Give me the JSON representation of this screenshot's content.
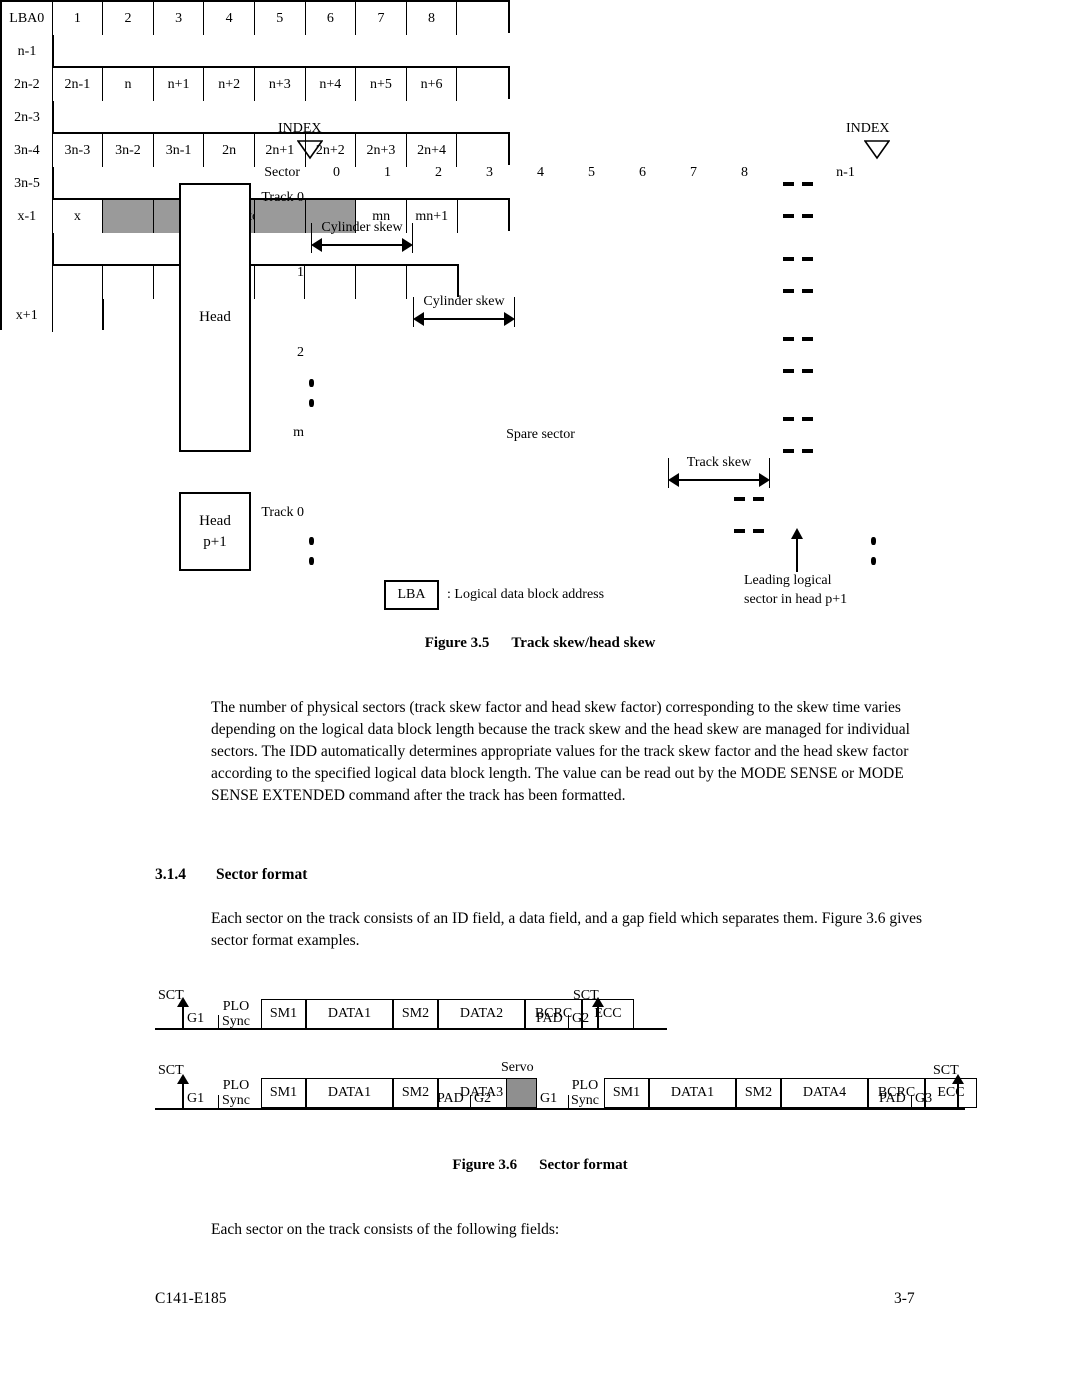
{
  "figure35": {
    "index_left_label": "INDEX",
    "index_right_label": "INDEX",
    "sector_label": "Sector",
    "head_label": "Head",
    "head2_label_line1": "Head",
    "head2_label_line2": "p+1",
    "sector_numbers": [
      "0",
      "1",
      "2",
      "3",
      "4",
      "5",
      "6",
      "7",
      "8"
    ],
    "sector_number_last": "n-1",
    "rows": [
      {
        "label": "Track 0",
        "cells": [
          "LBA0",
          "1",
          "2",
          "3",
          "4",
          "5",
          "6",
          "7",
          "8",
          ""
        ],
        "tail": [
          "n-1"
        ]
      },
      {
        "label": "1",
        "cells": [
          "2n-2",
          "2n-1",
          "n",
          "n+1",
          "n+2",
          "n+3",
          "n+4",
          "n+5",
          "n+6",
          ""
        ],
        "tail": [
          "2n-3"
        ]
      },
      {
        "label": "2",
        "cells": [
          "3n-4",
          "3n-3",
          "3n-2",
          "3n-1",
          "2n",
          "2n+1",
          "2n+2",
          "2n+3",
          "2n+4",
          ""
        ],
        "tail": [
          "3n-5"
        ]
      },
      {
        "label": "m",
        "cells": [
          "x-1",
          "x",
          "",
          "",
          "Spare sector",
          "",
          "",
          "mn",
          "mn+1",
          ""
        ],
        "tail": [
          ""
        ]
      }
    ],
    "last_row": {
      "label": "Track 0",
      "cells": [
        "",
        "",
        "",
        "",
        "",
        "",
        "",
        "",
        ""
      ],
      "tail": [
        "x+1",
        ""
      ]
    },
    "spare_sector_text": "Spare sector",
    "cylinder_skew_1": "Cylinder skew",
    "cylinder_skew_2": "Cylinder skew",
    "track_skew": "Track skew",
    "lba_box": "LBA",
    "lba_desc": ": Logical data block address",
    "leading_note_line1": "Leading logical",
    "leading_note_line2": "sector in head p+1",
    "caption_num": "Figure 3.5",
    "caption_text": "Track skew/head skew"
  },
  "body": {
    "paragraph1": "The number of physical sectors (track skew factor and head skew factor) corresponding to the skew time varies depending on the logical data block length because the track skew and the head skew are managed for individual sectors.  The IDD automatically determines appropriate values for the track skew factor and the head skew factor according to the specified logical data block length.  The value can be read out by the MODE SENSE or MODE SENSE EXTENDED command after the track has been formatted.",
    "section_number": "3.1.4",
    "section_title": "Sector format",
    "paragraph2": "Each sector on the track consists of an ID field, a data field, and a gap field which separates them.  Figure 3.6 gives sector format examples.",
    "paragraph3": "Each sector on the track consists of the following fields:"
  },
  "figure36": {
    "caption_num": "Figure 3.6",
    "caption_text": "Sector format",
    "sct_label": "SCT",
    "servo_label": "Servo",
    "row1": {
      "pre_labels": [
        "G1",
        "PLO",
        "Sync"
      ],
      "boxes": [
        "SM1",
        "DATA1",
        "SM2",
        "DATA2",
        "BCRC",
        "ECC"
      ],
      "post_labels": [
        "PAD",
        "G2"
      ]
    },
    "row2": {
      "pre_labels": [
        "G1",
        "PLO",
        "Sync"
      ],
      "boxes": [
        "SM1",
        "DATA1",
        "SM2",
        "DATA3"
      ],
      "mid_labels": [
        "PAD",
        "G2"
      ],
      "servo": "Servo",
      "pre_labels2": [
        "G1",
        "PLO",
        "Sync"
      ],
      "boxes2": [
        "SM1",
        "DATA1",
        "SM2",
        "DATA4",
        "BCRC",
        "ECC"
      ],
      "post_labels": [
        "PAD",
        "G3"
      ]
    }
  },
  "footer": {
    "doc_id": "C141-E185",
    "page_number": "3-7"
  }
}
